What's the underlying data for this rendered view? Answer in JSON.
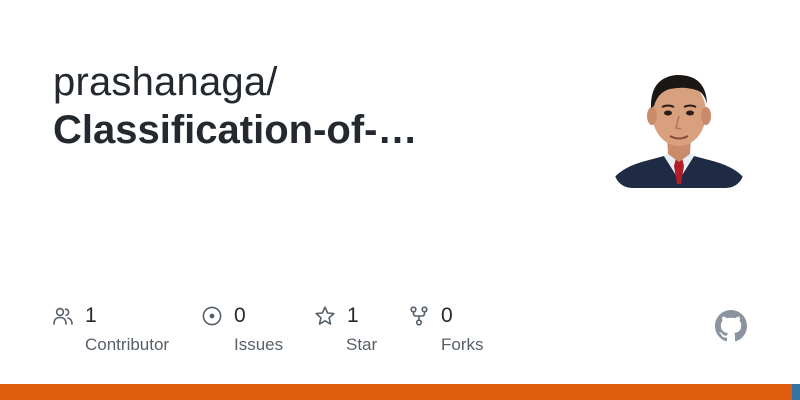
{
  "repo": {
    "owner": "prashanaga/",
    "name": "Classification-of-…"
  },
  "stats": {
    "contributors": {
      "count": "1",
      "label": "Contributor",
      "icon": "people-icon"
    },
    "issues": {
      "count": "0",
      "label": "Issues",
      "icon": "issue-opened-icon"
    },
    "stars": {
      "count": "1",
      "label": "Star",
      "icon": "star-icon"
    },
    "forks": {
      "count": "0",
      "label": "Forks",
      "icon": "repo-forked-icon"
    }
  },
  "colors": {
    "text_primary": "#24292f",
    "text_secondary": "#57606a",
    "language_bar_primary": "#e05d10",
    "language_bar_secondary": "#3572a5"
  }
}
